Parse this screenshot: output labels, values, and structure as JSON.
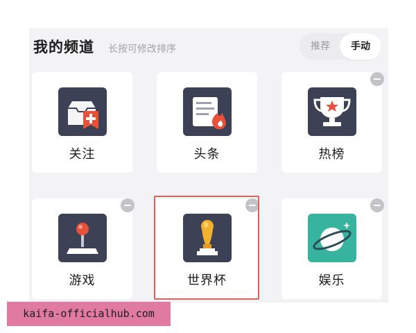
{
  "header": {
    "title": "我的频道",
    "hint": "长按可修改排序",
    "toggle": {
      "recommend_label": "推荐",
      "manual_label": "手动",
      "selected": "手动"
    }
  },
  "channels": [
    {
      "label": "关注",
      "icon": "follow-inbox-icon"
    },
    {
      "label": "头条",
      "icon": "headline-flame-icon"
    },
    {
      "label": "热榜",
      "icon": "trophy-star-icon"
    },
    {
      "label": "游戏",
      "icon": "joystick-icon"
    },
    {
      "label": "世界杯",
      "icon": "world-cup-trophy-icon"
    },
    {
      "label": "娱乐",
      "icon": "planet-icon"
    }
  ],
  "colors": {
    "icon_dark": "#3d4155",
    "icon_teal": "#37b39e",
    "accent_red": "#e8503a",
    "highlight_border": "#d2645f"
  },
  "watermark": "kaifa-officialhub.com"
}
